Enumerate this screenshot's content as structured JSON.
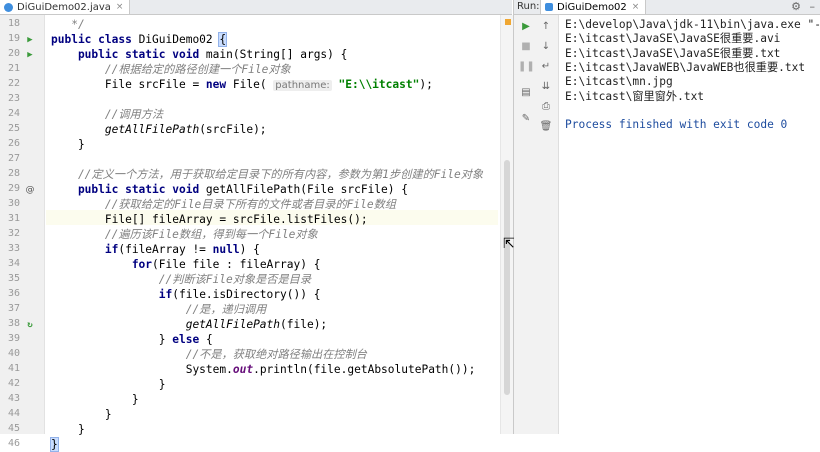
{
  "editor": {
    "tab_title": "DiGuiDemo02.java",
    "tab_close": "×",
    "lines": [
      {
        "n": "18",
        "icon": "",
        "text": [
          {
            "c": "cm",
            "t": "   */"
          }
        ]
      },
      {
        "n": "19",
        "icon": "run",
        "text": [
          {
            "c": "kw",
            "t": "public class "
          },
          {
            "c": "",
            "t": "DiGuiDemo02 "
          },
          {
            "c": "brace",
            "t": "{"
          }
        ]
      },
      {
        "n": "20",
        "icon": "run",
        "text": [
          {
            "c": "kw",
            "t": "    public static void "
          },
          {
            "c": "",
            "t": "main(String[] args) {"
          }
        ]
      },
      {
        "n": "21",
        "icon": "",
        "text": [
          {
            "c": "cm",
            "t": "        //根据给定的路径创建一个File对象"
          }
        ]
      },
      {
        "n": "22",
        "icon": "",
        "text": [
          {
            "c": "",
            "t": "        File srcFile = "
          },
          {
            "c": "kw",
            "t": "new "
          },
          {
            "c": "",
            "t": "File( "
          },
          {
            "c": "hint",
            "t": "pathname:"
          },
          {
            "c": "st",
            "t": " \"E:\\\\itcast\""
          },
          {
            "c": "",
            "t": ");"
          }
        ]
      },
      {
        "n": "23",
        "icon": "",
        "text": []
      },
      {
        "n": "24",
        "icon": "",
        "text": [
          {
            "c": "cm",
            "t": "        //调用方法"
          }
        ]
      },
      {
        "n": "25",
        "icon": "",
        "text": [
          {
            "c": "it",
            "t": "        getAllFilePath"
          },
          {
            "c": "",
            "t": "(srcFile);"
          }
        ]
      },
      {
        "n": "26",
        "icon": "",
        "text": [
          {
            "c": "",
            "t": "    }"
          }
        ]
      },
      {
        "n": "27",
        "icon": "",
        "text": []
      },
      {
        "n": "28",
        "icon": "",
        "text": [
          {
            "c": "cm",
            "t": "    //定义一个方法，用于获取给定目录下的所有内容，参数为第1步创建的File对象"
          }
        ]
      },
      {
        "n": "29",
        "icon": "at",
        "text": [
          {
            "c": "kw",
            "t": "    public static void "
          },
          {
            "c": "",
            "t": "getAllFilePath(File srcFile) {"
          }
        ]
      },
      {
        "n": "30",
        "icon": "",
        "text": [
          {
            "c": "cm",
            "t": "        //获取给定的File目录下所有的文件或者目录的File数组"
          }
        ]
      },
      {
        "n": "31",
        "icon": "",
        "text": [
          {
            "c": "",
            "t": "        File[] fileArray = srcFile.listFiles();"
          }
        ]
      },
      {
        "n": "32",
        "icon": "",
        "text": [
          {
            "c": "cm",
            "t": "        //遍历该File数组，得到每一个File对象"
          }
        ]
      },
      {
        "n": "33",
        "icon": "",
        "text": [
          {
            "c": "kw",
            "t": "        if"
          },
          {
            "c": "",
            "t": "(fileArray != "
          },
          {
            "c": "kw",
            "t": "null"
          },
          {
            "c": "",
            "t": ") {"
          }
        ]
      },
      {
        "n": "34",
        "icon": "",
        "text": [
          {
            "c": "kw",
            "t": "            for"
          },
          {
            "c": "",
            "t": "(File file : fileArray) {"
          }
        ]
      },
      {
        "n": "35",
        "icon": "",
        "text": [
          {
            "c": "cm",
            "t": "                //判断该File对象是否是目录"
          }
        ]
      },
      {
        "n": "36",
        "icon": "",
        "text": [
          {
            "c": "kw",
            "t": "                if"
          },
          {
            "c": "",
            "t": "(file.isDirectory()) {"
          }
        ]
      },
      {
        "n": "37",
        "icon": "",
        "text": [
          {
            "c": "cm",
            "t": "                    //是，递归调用"
          }
        ]
      },
      {
        "n": "38",
        "icon": "rec",
        "text": [
          {
            "c": "it",
            "t": "                    getAllFilePath"
          },
          {
            "c": "",
            "t": "(file);"
          }
        ]
      },
      {
        "n": "39",
        "icon": "",
        "text": [
          {
            "c": "",
            "t": "                } "
          },
          {
            "c": "kw",
            "t": "else "
          },
          {
            "c": "",
            "t": "{"
          }
        ]
      },
      {
        "n": "40",
        "icon": "",
        "text": [
          {
            "c": "cm",
            "t": "                    //不是，获取绝对路径输出在控制台"
          }
        ]
      },
      {
        "n": "41",
        "icon": "",
        "text": [
          {
            "c": "",
            "t": "                    System."
          },
          {
            "c": "fd",
            "t": "out"
          },
          {
            "c": "",
            "t": ".println(file.getAbsolutePath());"
          }
        ]
      },
      {
        "n": "42",
        "icon": "",
        "text": [
          {
            "c": "",
            "t": "                }"
          }
        ]
      },
      {
        "n": "43",
        "icon": "",
        "text": [
          {
            "c": "",
            "t": "            }"
          }
        ]
      },
      {
        "n": "44",
        "icon": "",
        "text": [
          {
            "c": "",
            "t": "        }"
          }
        ]
      },
      {
        "n": "45",
        "icon": "",
        "text": [
          {
            "c": "",
            "t": "    }"
          }
        ]
      },
      {
        "n": "46",
        "icon": "",
        "text": [
          {
            "c": "brace",
            "t": "}"
          }
        ]
      }
    ]
  },
  "run": {
    "label": "Run:",
    "tab_title": "DiGuiDemo02",
    "tab_close": "×",
    "output": [
      "E:\\develop\\Java\\jdk-11\\bin\\java.exe \"-j",
      "E:\\itcast\\JavaSE\\JavaSE很重要.avi",
      "E:\\itcast\\JavaSE\\JavaSE很重要.txt",
      "E:\\itcast\\JavaWEB\\JavaWEB也很重要.txt",
      "E:\\itcast\\mn.jpg",
      "E:\\itcast\\窗里窗外.txt",
      "",
      "Process finished with exit code 0"
    ]
  }
}
